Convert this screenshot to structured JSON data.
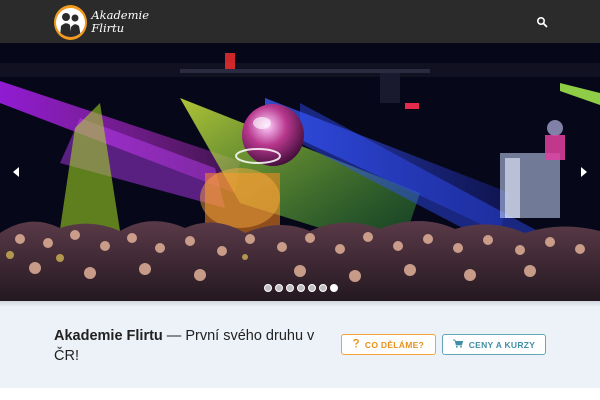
{
  "header": {
    "logo_line1": "Akademie",
    "logo_line2": "Flirtu",
    "logo_color": "#f29a1d",
    "search_icon": "search-icon",
    "background": "#2b2b2b"
  },
  "slider": {
    "prev_icon": "chevron-left-icon",
    "next_icon": "chevron-right-icon",
    "slide_count": 7,
    "active_slide": 7
  },
  "band": {
    "tagline_bold": "Akademie Flirtu",
    "tagline_rest": " — První svého druhu v ČR!",
    "button_primary": {
      "icon": "question-icon",
      "label": "CO DĚLÁME?",
      "color": "#e8901c"
    },
    "button_secondary": {
      "icon": "cart-icon",
      "label": "CENY A KURZY",
      "color": "#3f8ea5"
    },
    "background": "#edf2f8"
  }
}
